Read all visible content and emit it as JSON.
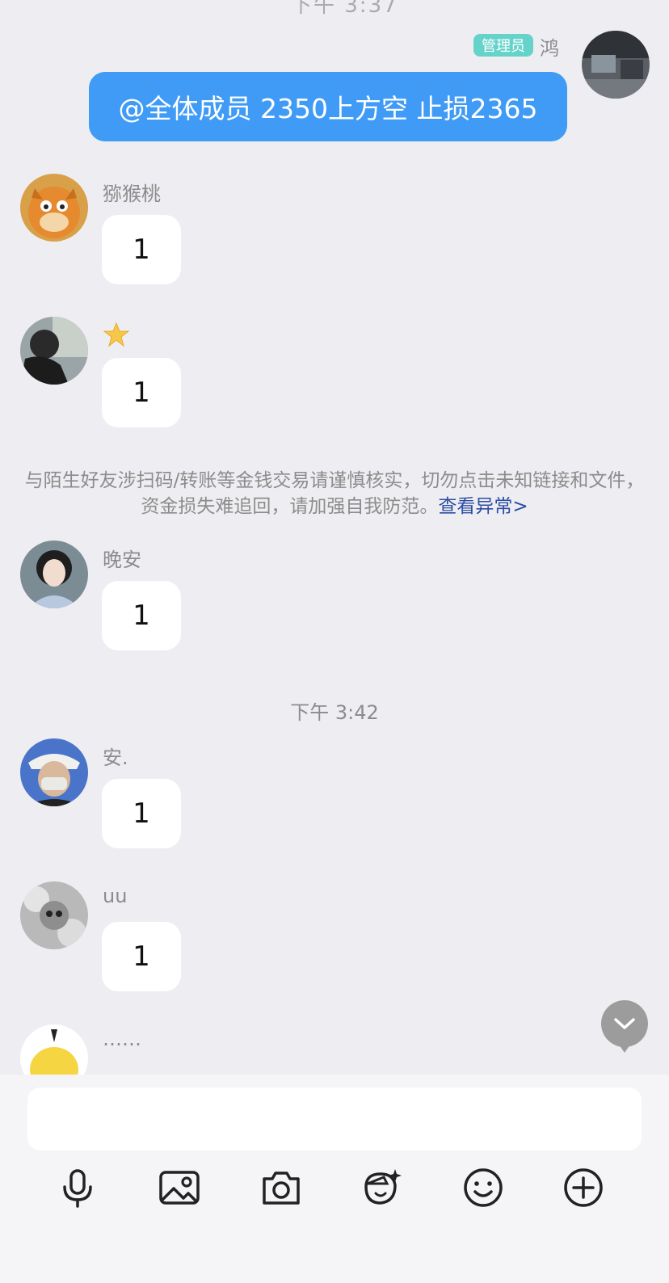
{
  "top_peek": "下午 3:37",
  "self_message": {
    "badge": "管理员",
    "name": "鸿",
    "text": "@全体成员 2350上方空 止损2365"
  },
  "messages": [
    {
      "name": "猕猴桃",
      "text": "1"
    },
    {
      "name": "",
      "text": "1"
    },
    {
      "name": "晚安",
      "text": "1"
    },
    {
      "name": "安.",
      "text": "1"
    },
    {
      "name": "uu",
      "text": "1"
    },
    {
      "name": "……",
      "text": ""
    }
  ],
  "notice": {
    "text": "与陌生好友涉扫码/转账等金钱交易请谨慎核实，切勿点击未知链接和文件，资金损失难追回，请加强自我防范。",
    "link": "查看异常>"
  },
  "timestamp": "下午 3:42",
  "input": {
    "placeholder": ""
  },
  "toolbar": [
    "mic-icon",
    "image-icon",
    "camera-icon",
    "sticker-icon",
    "emoji-icon",
    "plus-icon"
  ],
  "colors": {
    "background": "#eeeef2",
    "self_bubble": "#3f9bf5",
    "admin_badge": "#66d3cb",
    "link": "#2c4ea3"
  }
}
